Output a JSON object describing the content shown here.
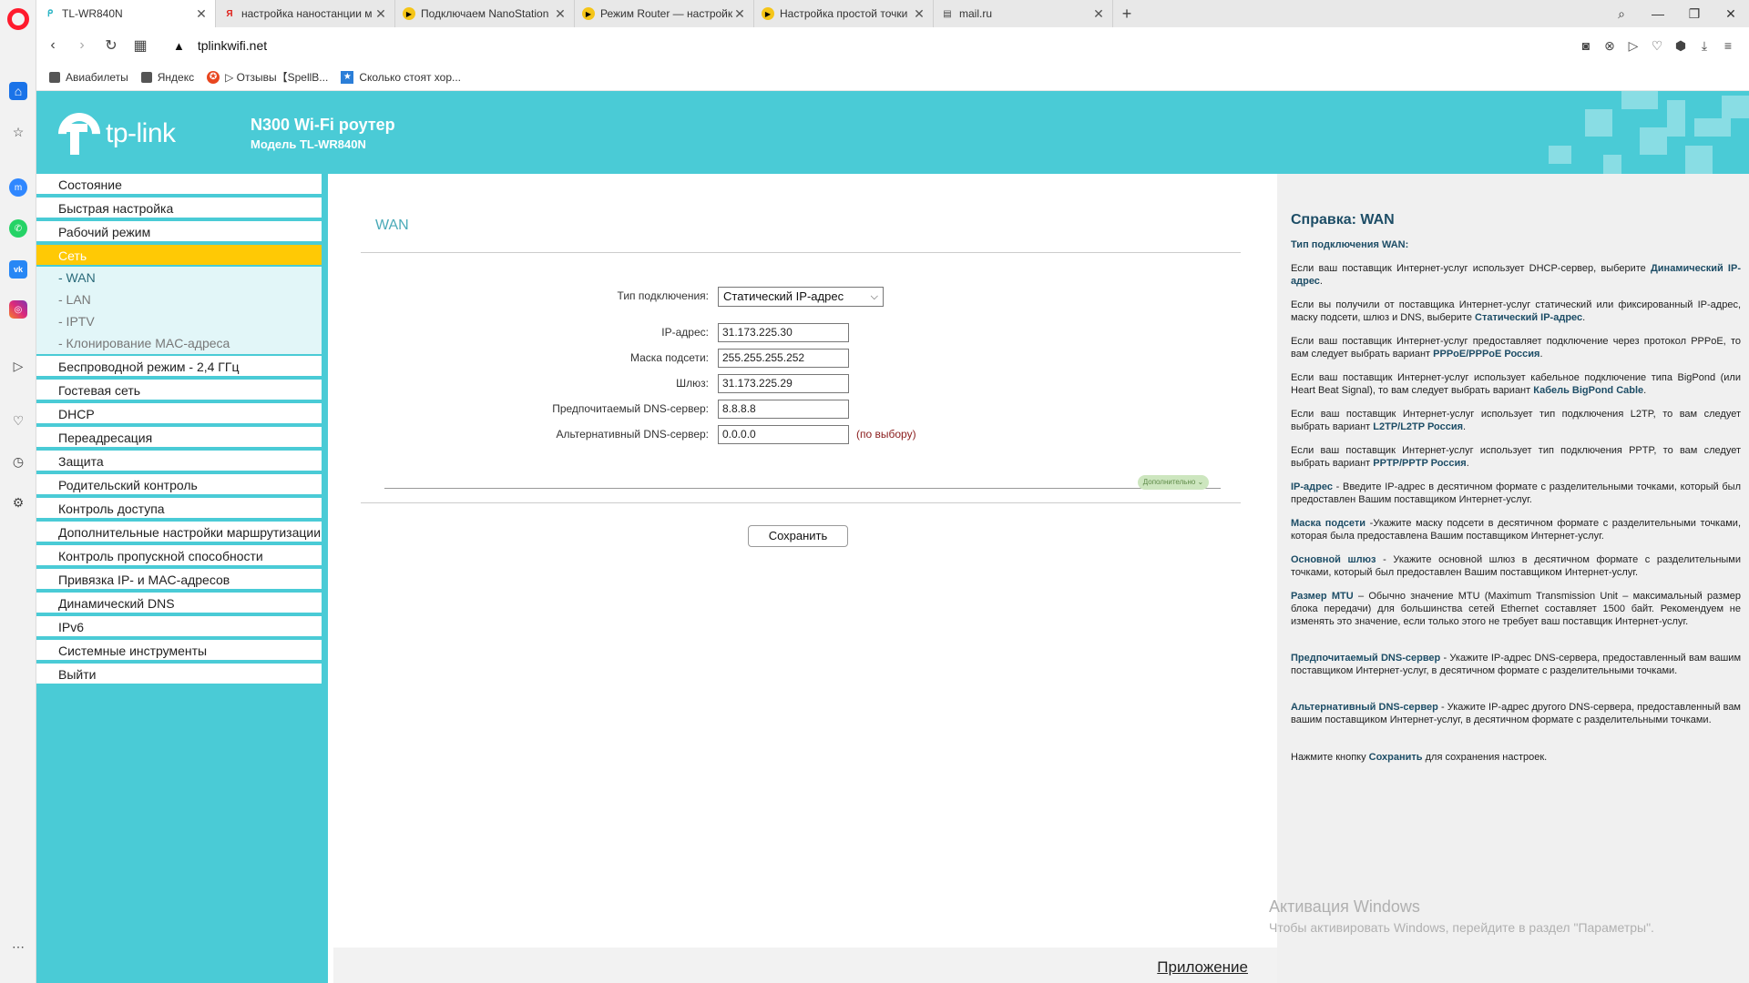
{
  "browser": {
    "tabs": [
      {
        "title": "TL-WR840N",
        "icon": "tplink-favicon",
        "active": true
      },
      {
        "title": "настройка наностанции м",
        "icon": "yandex-favicon"
      },
      {
        "title": "Подключаем NanoStation",
        "icon": "youtube-favicon"
      },
      {
        "title": "Режим Router — настройк",
        "icon": "youtube-favicon"
      },
      {
        "title": "Настройка простой точки",
        "icon": "youtube-favicon"
      },
      {
        "title": "mail.ru",
        "icon": "page-favicon"
      }
    ],
    "url": "tplinkwifi.net",
    "bookmarks": [
      {
        "label": "Авиабилеты",
        "icon": "folder-icon"
      },
      {
        "label": "Яндекс",
        "icon": "folder-icon"
      },
      {
        "label": "▷ Отзывы【SpellB...",
        "icon": "star-badge-icon"
      },
      {
        "label": "Сколько стоят хор...",
        "icon": "bookmark-star-icon"
      }
    ]
  },
  "router": {
    "brand": "tp-link",
    "model_title": "N300 Wi-Fi роутер",
    "model_subtitle": "Модель TL-WR840N",
    "menu": [
      {
        "label": "Состояние"
      },
      {
        "label": "Быстрая настройка"
      },
      {
        "label": "Рабочий режим"
      },
      {
        "label": "Сеть",
        "active": true
      },
      {
        "label": "Беспроводной режим - 2,4 ГГц"
      },
      {
        "label": "Гостевая сеть"
      },
      {
        "label": "DHCP"
      },
      {
        "label": "Переадресация"
      },
      {
        "label": "Защита"
      },
      {
        "label": "Родительский контроль"
      },
      {
        "label": "Контроль доступа"
      },
      {
        "label": "Дополнительные настройки маршрутизации"
      },
      {
        "label": "Контроль пропускной способности"
      },
      {
        "label": "Привязка IP- и MAC-адресов"
      },
      {
        "label": "Динамический DNS"
      },
      {
        "label": "IPv6"
      },
      {
        "label": "Системные инструменты"
      },
      {
        "label": "Выйти"
      }
    ],
    "submenu": [
      {
        "label": "- WAN",
        "current": true
      },
      {
        "label": "- LAN"
      },
      {
        "label": "- IPTV"
      },
      {
        "label": "- Клонирование MAC-адреса"
      }
    ],
    "page_title": "WAN",
    "form": {
      "connection_type_label": "Тип подключения:",
      "connection_type_value": "Статический IP-адрес",
      "ip_label": "IP-адрес:",
      "ip_value": "31.173.225.30",
      "mask_label": "Маска подсети:",
      "mask_value": "255.255.255.252",
      "gateway_label": "Шлюз:",
      "gateway_value": "31.173.225.29",
      "dns1_label": "Предпочитаемый DNS-сервер:",
      "dns1_value": "8.8.8.8",
      "dns2_label": "Альтернативный DNS-сервер:",
      "dns2_value": "0.0.0.0",
      "optional_note": "(по выбору)",
      "advanced_label": "Дополнительно ⌄",
      "save_label": "Сохранить"
    },
    "footer_link": "Приложение",
    "help": {
      "title": "Справка: WAN",
      "subtitle": "Тип подключения WAN:",
      "paragraphs": [
        {
          "text": "Если ваш поставщик Интернет-услуг использует DHCP-сервер, выберите ",
          "bold": "Динамический IP-адрес",
          "tail": "."
        },
        {
          "text": "Если вы получили от поставщика Интернет-услуг статический или фиксированный IP-адрес, маску подсети, шлюз и DNS, выберите ",
          "bold": "Статический IP-адрес",
          "tail": "."
        },
        {
          "text": "Если ваш поставщик Интернет-услуг предоставляет подключение через протокол PPPoE, то вам следует выбрать вариант ",
          "bold": "PPPoE/PPPoE Россия",
          "tail": "."
        },
        {
          "text": "Если ваш поставщик Интернет-услуг использует кабельное подключение типа BigPond (или Heart Beat Signal), то вам следует выбрать вариант ",
          "bold": "Кабель BigPond Cable",
          "tail": "."
        },
        {
          "text": "Если ваш поставщик Интернет-услуг использует тип подключения L2TP, то вам следует выбрать вариант ",
          "bold": "L2TP/L2TP Россия",
          "tail": "."
        },
        {
          "text": "Если ваш поставщик Интернет-услуг использует тип подключения PPTP, то вам следует выбрать вариант ",
          "bold": "PPTP/PPTP Россия",
          "tail": "."
        },
        {
          "lead": "IP-адрес",
          "text": " - Введите IP-адрес в десятичном формате с разделительными точками, который был предоставлен Вашим поставщиком Интернет-услуг."
        },
        {
          "lead": "Маска подсети",
          "text": " -Укажите маску подсети в десятичном формате с разделительными точками, которая была предоставлена Вашим поставщиком Интернет-услуг."
        },
        {
          "lead": "Основной шлюз",
          "text": " - Укажите основной шлюз в десятичном формате с разделительными точками, который был предоставлен Вашим поставщиком Интернет-услуг."
        },
        {
          "lead": "Размер MTU",
          "text": " – Обычно значение MTU (Maximum Transmission Unit – максимальный размер блока передачи) для большинства сетей Ethernet составляет 1500 байт. Рекомендуем не изменять это значение, если только этого не требует ваш поставщик Интернет-услуг."
        },
        {
          "lead": "Предпочитаемый DNS-сервер",
          "text": " - Укажите IP-адрес DNS-сервера, предоставленный вам вашим поставщиком Интернет-услуг, в десятичном формате с разделительными точками."
        },
        {
          "lead": "Альтернативный DNS-сервер",
          "text": " - Укажите IP-адрес другого DNS-сервера, предоставленный вам вашим поставщиком Интернет-услуг, в десятичном формате с разделительными точками."
        },
        {
          "text": "Нажмите кнопку ",
          "bold": "Сохранить",
          "tail": " для сохранения настроек."
        }
      ]
    }
  },
  "os": {
    "watermark_title": "Активация Windows",
    "watermark_text": "Чтобы активировать Windows, перейдите в раздел \"Параметры\"."
  },
  "colors": {
    "brand_teal": "#4acbd6",
    "active_menu": "#ffc905",
    "help_link": "#1d4d66",
    "optional_note": "#8a1c1c"
  }
}
